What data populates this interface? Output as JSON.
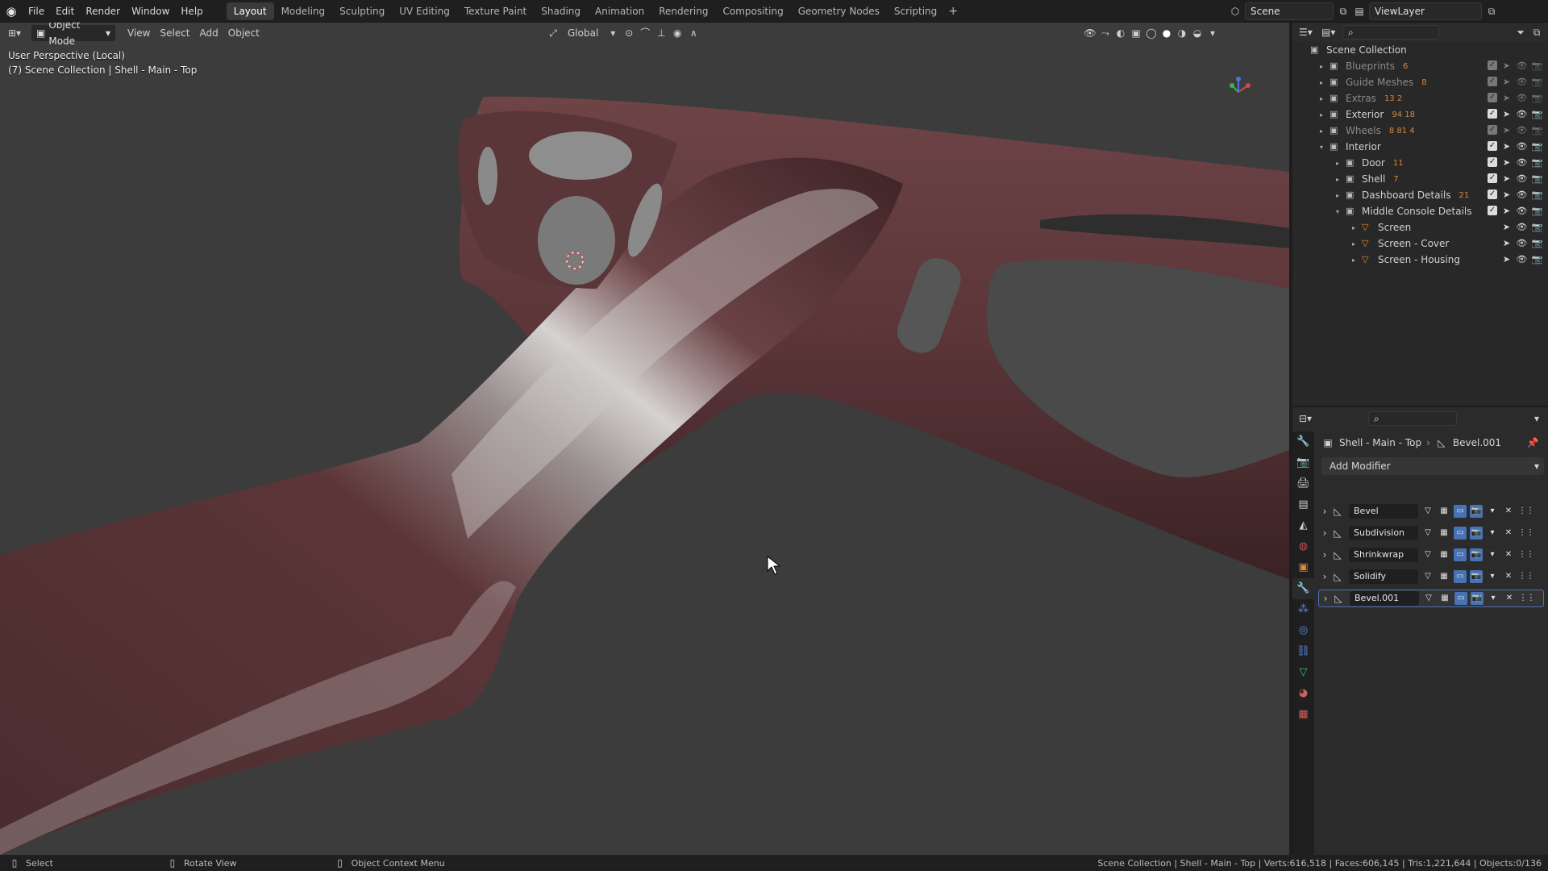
{
  "topbar": {
    "menus": [
      "File",
      "Edit",
      "Render",
      "Window",
      "Help"
    ],
    "workspaces": [
      "Layout",
      "Modeling",
      "Sculpting",
      "UV Editing",
      "Texture Paint",
      "Shading",
      "Animation",
      "Rendering",
      "Compositing",
      "Geometry Nodes",
      "Scripting"
    ],
    "active_workspace": "Layout",
    "scene": "Scene",
    "view_layer": "ViewLayer"
  },
  "viewport_header": {
    "mode": "Object Mode",
    "menus": [
      "View",
      "Select",
      "Add",
      "Object"
    ],
    "transform_orientation": "Global"
  },
  "viewport": {
    "perspective_label": "User Perspective (Local)",
    "object_label": "(7) Scene Collection | Shell - Main - Top"
  },
  "outliner": {
    "root": "Scene Collection",
    "rows": [
      {
        "label": "Blueprints",
        "badge": "6",
        "dim": true,
        "arrow": "▸",
        "indent": 0,
        "kind": "collection"
      },
      {
        "label": "Guide Meshes",
        "badge": "8",
        "dim": true,
        "arrow": "▸",
        "indent": 0,
        "kind": "collection"
      },
      {
        "label": "Extras",
        "badge": "13  2",
        "dim": true,
        "arrow": "▸",
        "indent": 0,
        "kind": "collection"
      },
      {
        "label": "Exterior",
        "badge": "94 18",
        "dim": false,
        "arrow": "▸",
        "indent": 0,
        "kind": "collection"
      },
      {
        "label": "Wheels",
        "badge": "8 81 4",
        "dim": true,
        "arrow": "▸",
        "indent": 0,
        "kind": "collection"
      },
      {
        "label": "Interior",
        "badge": "",
        "dim": false,
        "arrow": "▾",
        "indent": 0,
        "kind": "collection"
      },
      {
        "label": "Door",
        "badge": "11",
        "dim": false,
        "arrow": "▸",
        "indent": 1,
        "kind": "collection"
      },
      {
        "label": "Shell",
        "badge": "7",
        "dim": false,
        "arrow": "▸",
        "indent": 1,
        "kind": "collection"
      },
      {
        "label": "Dashboard Details",
        "badge": "21",
        "dim": false,
        "arrow": "▸",
        "indent": 1,
        "kind": "collection"
      },
      {
        "label": "Middle Console Details",
        "badge": "",
        "dim": false,
        "arrow": "▾",
        "indent": 1,
        "kind": "collection"
      },
      {
        "label": "Screen",
        "badge": "",
        "dim": false,
        "arrow": "▸",
        "indent": 2,
        "kind": "mesh"
      },
      {
        "label": "Screen - Cover",
        "badge": "",
        "dim": false,
        "arrow": "▸",
        "indent": 2,
        "kind": "mesh"
      },
      {
        "label": "Screen - Housing",
        "badge": "",
        "dim": false,
        "arrow": "▸",
        "indent": 2,
        "kind": "mesh"
      }
    ]
  },
  "properties": {
    "breadcrumb_object": "Shell - Main - Top",
    "breadcrumb_modifier": "Bevel.001",
    "add_modifier_label": "Add Modifier",
    "modifiers": [
      {
        "name": "Bevel",
        "icon": "bevel-icon"
      },
      {
        "name": "Subdivision",
        "icon": "subdivision-icon"
      },
      {
        "name": "Shrinkwrap",
        "icon": "shrinkwrap-icon"
      },
      {
        "name": "Solidify",
        "icon": "solidify-icon"
      },
      {
        "name": "Bevel.001",
        "icon": "bevel-icon"
      }
    ]
  },
  "statusbar": {
    "left_hint": "Select",
    "mid_hint": "Rotate View",
    "right_hint": "Object Context Menu",
    "stats": "Scene Collection | Shell - Main - Top | Verts:616,518 | Faces:606,145 | Tris:1,221,644 | Objects:0/136"
  },
  "colors": {
    "accent": "#4772b3",
    "viewport_bg": "#3c3c3c",
    "mesh_color": "#5a3436"
  }
}
